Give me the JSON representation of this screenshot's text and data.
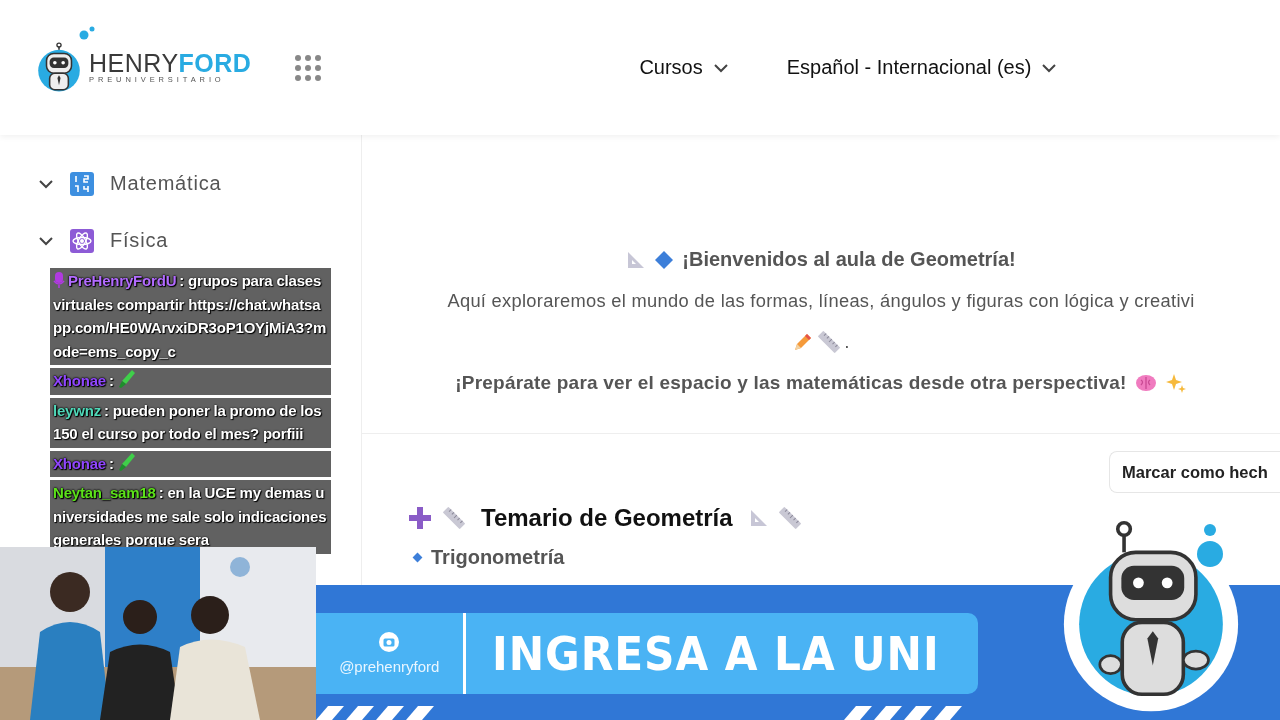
{
  "header": {
    "logo": {
      "word_1": "HENRY",
      "word_2": "FORD",
      "tagline": "PREUNIVERSITARIO"
    },
    "nav": [
      {
        "label": "Cursos"
      },
      {
        "label": "Español - Internacional (es)"
      }
    ]
  },
  "sidebar": {
    "items": [
      {
        "label": "Matemática"
      },
      {
        "label": "Física"
      }
    ]
  },
  "welcome": {
    "title": "¡Bienvenidos al aula de Geometría!",
    "intro": "Aquí exploraremos el mundo de las formas, líneas, ángulos y figuras con lógica y creativi",
    "intro_end": ".",
    "closing": "¡Prepárate para ver el espacio y las matemáticas desde otra perspectiva!"
  },
  "mark_done_button": "Marcar como hech",
  "syllabus": {
    "title": "Temario de Geometría",
    "topics": [
      "Trigonometría"
    ]
  },
  "chat": [
    {
      "user": "PreHenryFordU",
      "color": "#b36bff",
      "badge": true,
      "emote": false,
      "text": ": grupos para clases virtuales compartir https://chat.whatsapp.com/HE0WArvxiDR3oP1OYjMiA3?mode=ems_copy_c"
    },
    {
      "user": "Xhonae",
      "color": "#9146ff",
      "badge": false,
      "emote": true,
      "text": ":"
    },
    {
      "user": "leywnz",
      "color": "#4fd8b8",
      "badge": false,
      "emote": false,
      "text": ": pueden poner la promo de los 150 el curso por todo el mes? porfiii"
    },
    {
      "user": "Xhonae",
      "color": "#9146ff",
      "badge": false,
      "emote": true,
      "text": ":"
    },
    {
      "user": "Neytan_sam18",
      "color": "#5ce21a",
      "badge": false,
      "emote": false,
      "text": ": en la UCE my demas universidades me sale solo indicaciones generales porque sera"
    }
  ],
  "banner": {
    "handle": "@prehenryford",
    "slogan": "INGRESA A LA UNI"
  }
}
